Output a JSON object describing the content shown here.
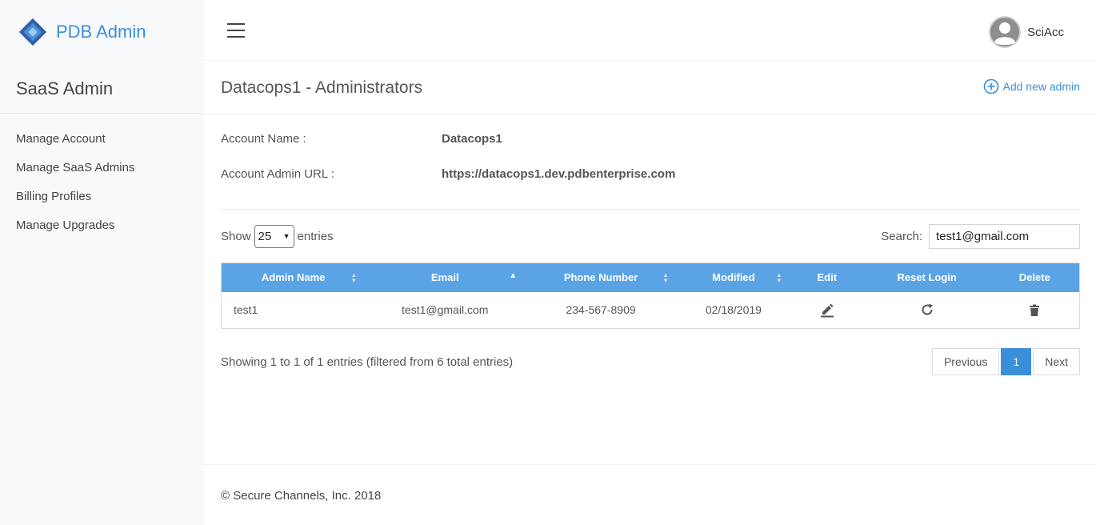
{
  "brand": {
    "name": "PDB Admin"
  },
  "sidebar": {
    "section_title": "SaaS Admin",
    "items": [
      {
        "label": "Manage Account"
      },
      {
        "label": "Manage SaaS Admins"
      },
      {
        "label": "Billing Profiles"
      },
      {
        "label": "Manage Upgrades"
      }
    ]
  },
  "header": {
    "user_name": "SciAcc"
  },
  "page": {
    "title": "Datacops1 - Administrators",
    "add_label": "Add new admin"
  },
  "account": {
    "name_label": "Account Name :",
    "name_value": "Datacops1",
    "url_label": "Account Admin URL :",
    "url_value": "https://datacops1.dev.pdbenterprise.com"
  },
  "table_controls": {
    "show_label": "Show",
    "page_size": "25",
    "entries_label": "entries",
    "search_label": "Search:",
    "search_value": "test1@gmail.com"
  },
  "table": {
    "columns": [
      "Admin Name",
      "Email",
      "Phone Number",
      "Modified",
      "Edit",
      "Reset Login",
      "Delete"
    ],
    "rows": [
      {
        "admin_name": "test1",
        "email": "test1@gmail.com",
        "phone": "234-567-8909",
        "modified": "02/18/2019"
      }
    ]
  },
  "pagination": {
    "summary": "Showing 1 to 1 of 1 entries (filtered from 6 total entries)",
    "previous": "Previous",
    "current": "1",
    "next": "Next"
  },
  "footer": {
    "copyright": "© Secure Channels, Inc. 2018"
  },
  "colors": {
    "accent": "#3a8fd9",
    "table_header": "#5aa4e6",
    "sidebar_bg": "#f7f9fa"
  },
  "icons": {
    "logo": "diamond-logo-icon",
    "menu": "hamburger-icon",
    "avatar": "user-avatar-icon",
    "add": "plus-circle-icon",
    "edit": "pencil-icon",
    "reset": "refresh-icon",
    "delete": "trash-icon"
  }
}
